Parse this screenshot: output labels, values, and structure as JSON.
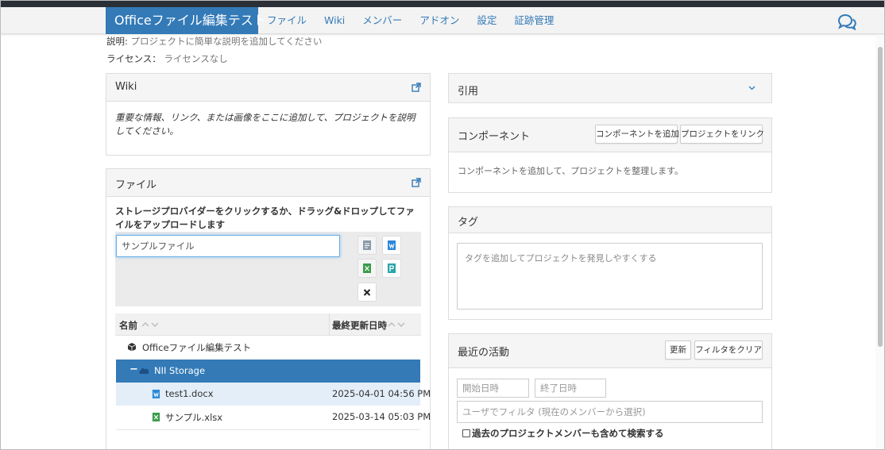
{
  "app": {
    "project_title": "Officeファイル編集テスト",
    "nav": [
      "ファイル",
      "Wiki",
      "メンバー",
      "アドオン",
      "設定",
      "証跡管理"
    ]
  },
  "meta": {
    "desc_label": "説明:",
    "desc_value": "プロジェクトに簡単な説明を追加してください",
    "license_label": "ライセンス：",
    "license_value": "ライセンスなし"
  },
  "wiki": {
    "title": "Wiki",
    "body": "重要な情報、リンク、または画像をここに追加して、プロジェクトを説明してください。"
  },
  "files": {
    "title": "ファイル",
    "instructions": "ストレージプロバイダーをクリックするか、ドラッグ&ドロップしてファイルをアップロードします",
    "search_value": "サンプルファイル",
    "col_name": "名前",
    "col_modified": "最終更新日時",
    "tree": [
      {
        "name": "Officeファイル編集テスト",
        "modified": "",
        "icon": "cube-icon"
      },
      {
        "name": "NII Storage",
        "modified": "",
        "icon": "cloud-icon",
        "toggle": "−"
      },
      {
        "name": "test1.docx",
        "modified": "2025-04-01 04:56 PM",
        "icon": "word-icon"
      },
      {
        "name": "サンプル.xlsx",
        "modified": "2025-03-14 05:03 PM",
        "icon": "excel-icon"
      }
    ]
  },
  "citation": {
    "title": "引用"
  },
  "components": {
    "title": "コンポーネント",
    "add_btn": "コンポーネントを追加",
    "link_btn": "プロジェクトをリンク",
    "body": "コンポーネントを追加して、プロジェクトを整理します。"
  },
  "tags": {
    "title": "タグ",
    "placeholder": "タグを追加してプロジェクトを発見しやすくする"
  },
  "activity": {
    "title": "最近の活動",
    "refresh_btn": "更新",
    "clear_btn": "フィルタをクリア",
    "start_placeholder": "開始日時",
    "end_placeholder": "終了日時",
    "user_placeholder": "ユーザでフィルタ (現在のメンバーから選択)",
    "include_past": "過去のプロジェクトメンバーも含めて検索する"
  },
  "colors": {
    "brand": "#337ab7",
    "selected_row": "#337ab7",
    "hover_row": "#e3eef8"
  }
}
